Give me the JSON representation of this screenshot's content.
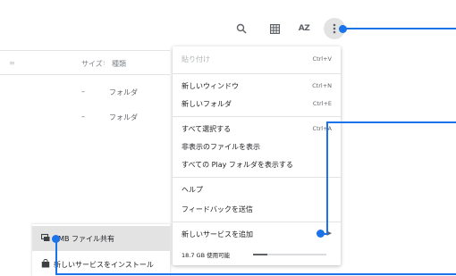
{
  "toolbar": {
    "search_icon": "search-icon",
    "grid_icon": "grid-view-icon",
    "sort_label": "AZ",
    "more_icon": "more-vert-icon"
  },
  "file_list": {
    "header": {
      "size": "サイズ",
      "type": "種類"
    },
    "rows": [
      {
        "size": "–",
        "type": "フォルダ"
      },
      {
        "size": "–",
        "type": "フォルダ"
      }
    ]
  },
  "menu": {
    "paste": {
      "label": "貼り付け",
      "shortcut": "Ctrl+V"
    },
    "new_window": {
      "label": "新しいウィンドウ",
      "shortcut": "Ctrl+N"
    },
    "new_folder": {
      "label": "新しいフォルダ",
      "shortcut": "Ctrl+E"
    },
    "select_all": {
      "label": "すべて選択する",
      "shortcut": "Ctrl+A"
    },
    "show_hidden": {
      "label": "非表示のファイルを表示"
    },
    "show_play": {
      "label": "すべての Play フォルダを表示する"
    },
    "help": {
      "label": "ヘルプ"
    },
    "feedback": {
      "label": "フィードバックを送信"
    },
    "add_service": {
      "label": "新しいサービスを追加"
    },
    "storage": {
      "label": "18.7 GB 使用可能",
      "used_fraction": 0.2
    }
  },
  "bottom_panel": {
    "smb": {
      "label": "SMB ファイル共有",
      "icon": "smb-share-icon"
    },
    "install": {
      "label": "新しいサービスをインストール",
      "icon": "shopping-bag-icon"
    }
  },
  "colors": {
    "annotation": "#1a73e8",
    "highlight": "#e3e3e3"
  }
}
